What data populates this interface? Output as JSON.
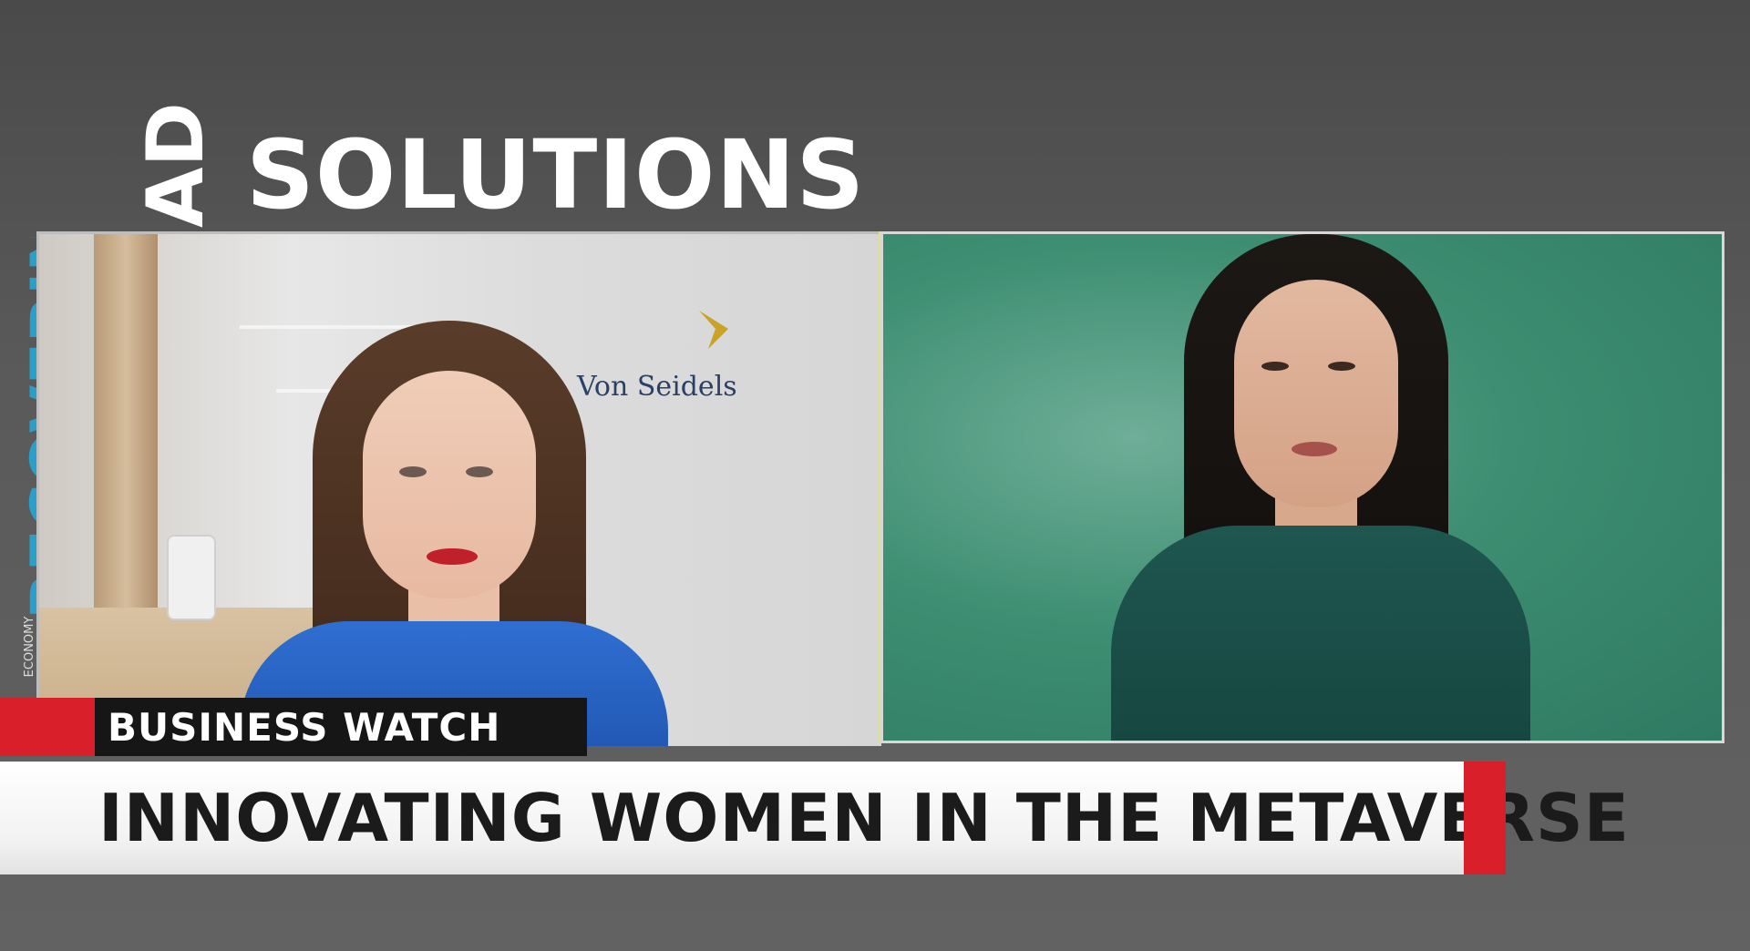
{
  "background": {
    "solutions_text": "SOLUTIONS",
    "ad_text": "AD",
    "recovering_text": "RECOVERING",
    "economy_text": "ECONOMY"
  },
  "panes": {
    "left": {
      "logo_text": "Von Seidels",
      "logo_icon": "chevron-logo-icon"
    },
    "right": {}
  },
  "lower_third": {
    "segment": "BUSINESS WATCH",
    "headline": "INNOVATING WOMEN IN THE METAVERSE"
  },
  "colors": {
    "accent_red": "#d9202a",
    "segment_bg": "#161616",
    "headline_bg": "#ffffff",
    "right_pane_green": "#3d8e72",
    "logo_gold": "#c9a227",
    "recovering_blue": "#2a9fc9"
  }
}
